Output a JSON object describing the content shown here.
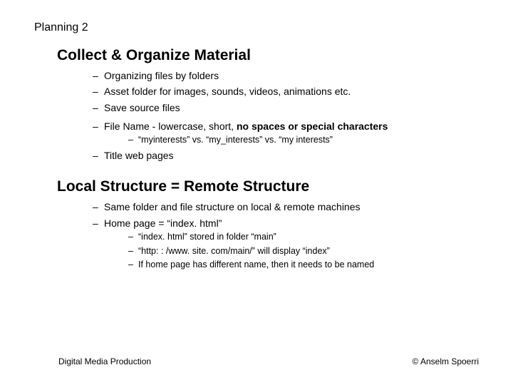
{
  "title": "Planning 2",
  "section1": {
    "heading": "Collect & Organize Material",
    "items": {
      "i0": "Organizing files by folders",
      "i1": "Asset folder for images, sounds, videos, animations etc.",
      "i2": "Save source files",
      "i3_prefix": "File Name - lowercase, short, ",
      "i3_bold": "no spaces or special characters",
      "i3_sub0": "“myinterests” vs. “my_interests” vs. “my interests”",
      "i4": "Title web pages"
    }
  },
  "section2": {
    "heading": "Local Structure = Remote Structure",
    "items": {
      "i0": "Same folder and file structure on local & remote machines",
      "i1": "Home page = “index. html”",
      "i1_sub0": "“index. html” stored in folder “main”",
      "i1_sub1": "“http: : /www. site. com/main/”   will display   “index”",
      "i1_sub2": "If home page has different name, then it needs to be named"
    }
  },
  "footer": {
    "left": "Digital Media Production",
    "right": "© Anselm Spoerri"
  }
}
